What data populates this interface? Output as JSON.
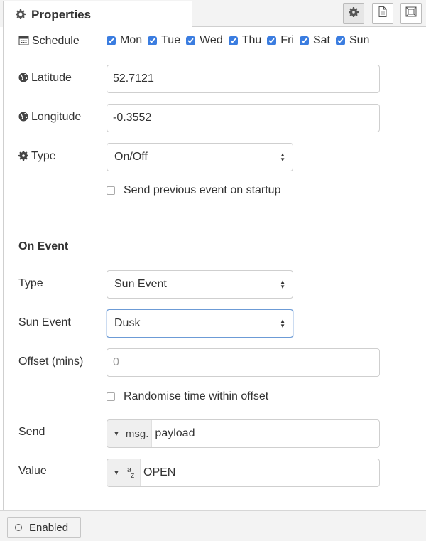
{
  "tabs": {
    "properties_label": "Properties"
  },
  "toolbar": {
    "settings_icon": "gear-icon",
    "description_icon": "document-icon",
    "appearance_icon": "frame-icon"
  },
  "schedule": {
    "label": "Schedule",
    "days": [
      {
        "label": "Mon",
        "checked": true
      },
      {
        "label": "Tue",
        "checked": true
      },
      {
        "label": "Wed",
        "checked": true
      },
      {
        "label": "Thu",
        "checked": true
      },
      {
        "label": "Fri",
        "checked": true
      },
      {
        "label": "Sat",
        "checked": true
      },
      {
        "label": "Sun",
        "checked": true
      }
    ]
  },
  "latitude": {
    "label": "Latitude",
    "value": "52.7121"
  },
  "longitude": {
    "label": "Longitude",
    "value": "-0.3552"
  },
  "type": {
    "label": "Type",
    "value": "On/Off"
  },
  "send_previous": {
    "label": "Send previous event on startup",
    "checked": false
  },
  "on_event": {
    "title": "On Event",
    "type": {
      "label": "Type",
      "value": "Sun Event"
    },
    "sun_event": {
      "label": "Sun Event",
      "value": "Dusk"
    },
    "offset": {
      "label": "Offset (mins)",
      "placeholder": "0"
    },
    "randomise": {
      "label": "Randomise time within offset",
      "checked": false
    },
    "send": {
      "label": "Send",
      "type_label": "msg.",
      "value": "payload"
    },
    "value": {
      "label": "Value",
      "type_label": "a z",
      "value": "OPEN"
    }
  },
  "footer": {
    "enabled_label": "Enabled"
  },
  "colors": {
    "accent": "#3b7de0",
    "focus_border": "#6c9bd6"
  }
}
